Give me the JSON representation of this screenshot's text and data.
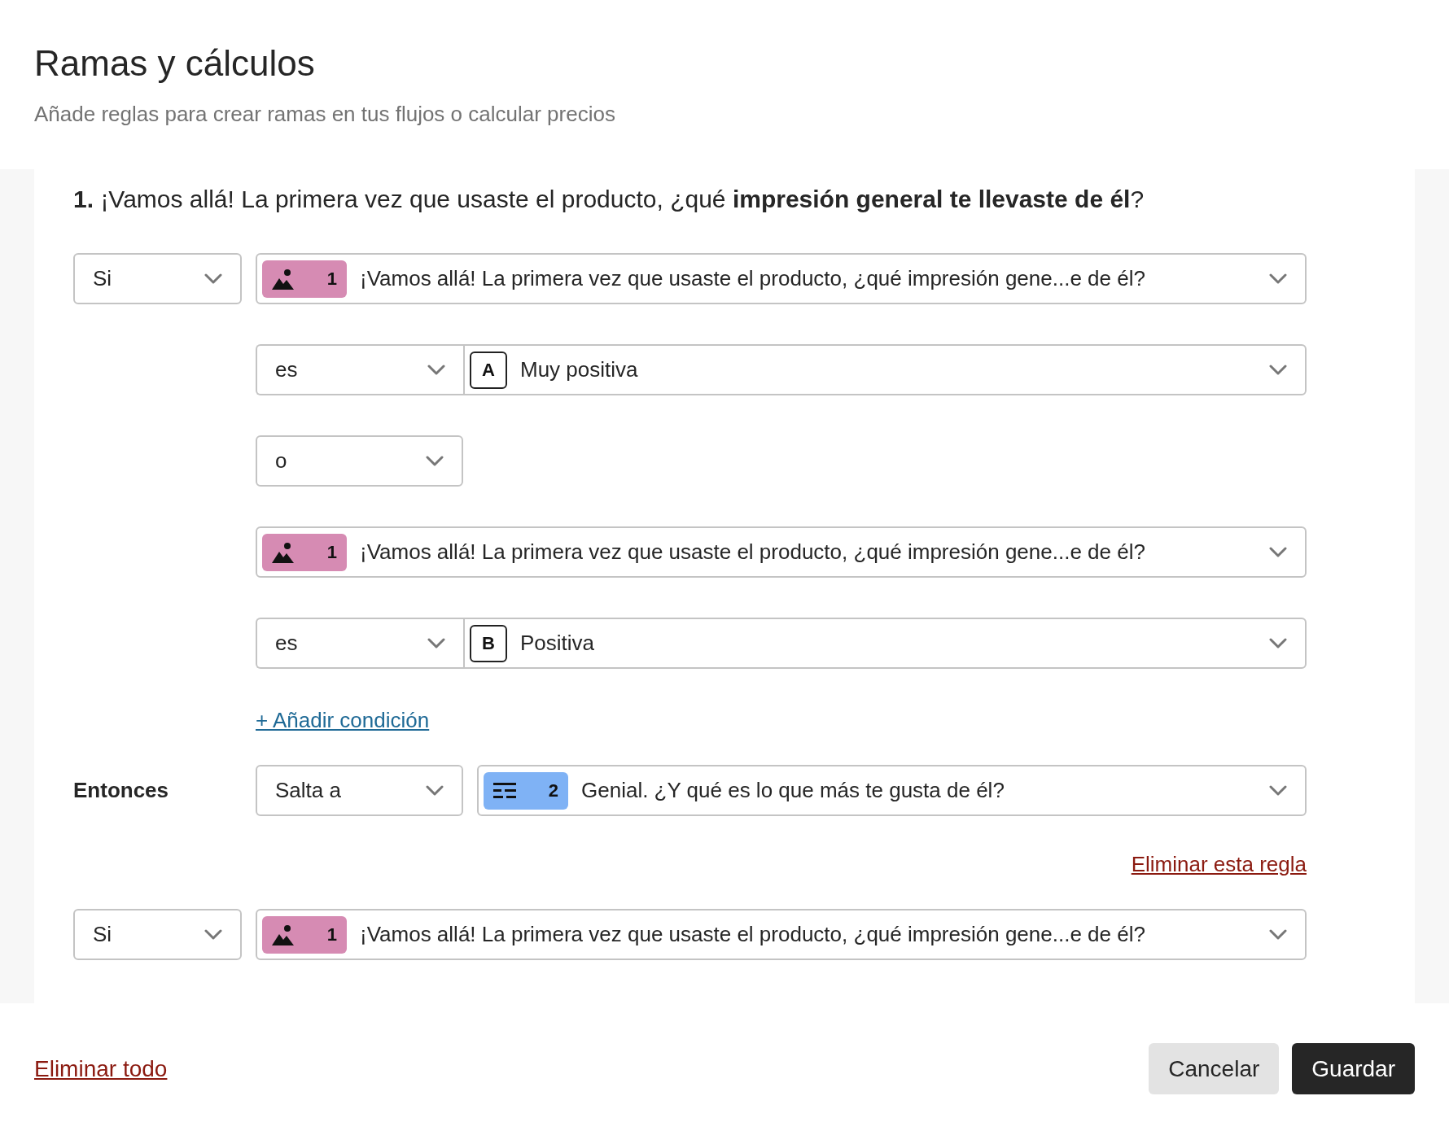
{
  "header": {
    "title": "Ramas y cálculos",
    "subtitle": "Añade reglas para crear ramas en tus flujos o calcular precios"
  },
  "question": {
    "number": "1.",
    "text": "¡Vamos allá! La primera vez que usaste el producto, ¿qué **impresión general te llevaste de él**?"
  },
  "rules": [
    {
      "keyword": "Si",
      "conditions": [
        {
          "kind": "question",
          "badge": {
            "kind": "picture",
            "number": "1",
            "color": "#d68bb3"
          },
          "text": "¡Vamos allá! La primera vez que usaste el producto, ¿qué impresión gene...e de él?"
        },
        {
          "kind": "comparison",
          "operator": "es",
          "letter": "A",
          "answer": "Muy positiva"
        },
        {
          "kind": "connector",
          "value": "o"
        },
        {
          "kind": "question",
          "badge": {
            "kind": "picture",
            "number": "1",
            "color": "#d68bb3"
          },
          "text": "¡Vamos allá! La primera vez que usaste el producto, ¿qué impresión gene...e de él?"
        },
        {
          "kind": "comparison",
          "operator": "es",
          "letter": "B",
          "answer": "Positiva"
        }
      ],
      "add_condition": "+ Añadir condición",
      "then": {
        "label": "Entonces",
        "action": "Salta a",
        "target": {
          "badge": {
            "kind": "list",
            "number": "2",
            "color": "#7fb2f5"
          },
          "text": "Genial. ¿Y qué es lo que más te gusta de él?"
        }
      },
      "delete": "Eliminar esta regla"
    },
    {
      "keyword": "Si",
      "conditions": [
        {
          "kind": "question",
          "badge": {
            "kind": "picture",
            "number": "1",
            "color": "#d68bb3"
          },
          "text": "¡Vamos allá! La primera vez que usaste el producto, ¿qué impresión gene...e de él?"
        }
      ]
    }
  ],
  "footer": {
    "delete_all": "Eliminar todo",
    "cancel": "Cancelar",
    "save": "Guardar"
  }
}
